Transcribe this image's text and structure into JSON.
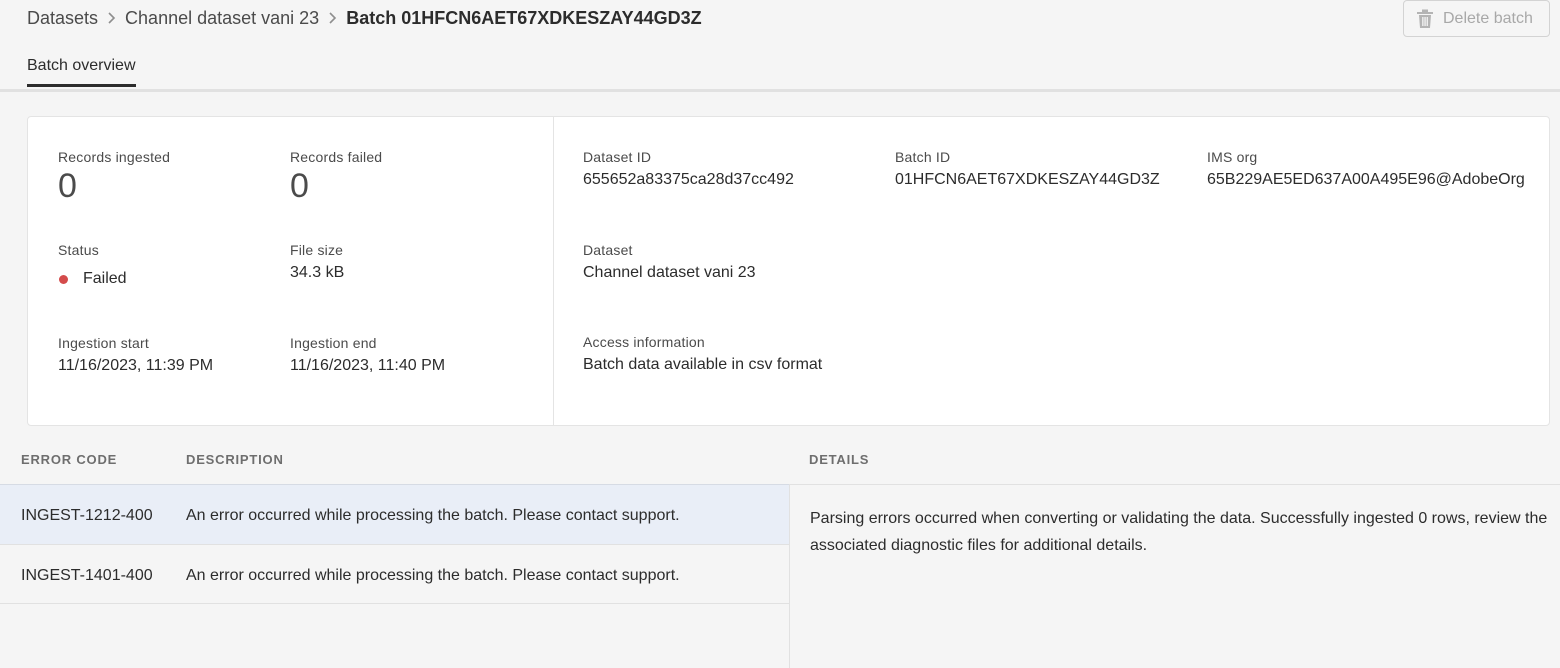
{
  "breadcrumb": {
    "items": [
      "Datasets",
      "Channel dataset vani 23"
    ],
    "current": "Batch 01HFCN6AET67XDKESZAY44GD3Z"
  },
  "actions": {
    "delete_label": "Delete batch",
    "delete_icon": "trash-icon",
    "delete_disabled": true
  },
  "tabs": [
    {
      "label": "Batch overview",
      "active": true
    }
  ],
  "overview": {
    "records_ingested_label": "Records ingested",
    "records_ingested": "0",
    "records_failed_label": "Records failed",
    "records_failed": "0",
    "status_label": "Status",
    "status": "Failed",
    "status_color": "#d44b4b",
    "file_size_label": "File size",
    "file_size": "34.3 kB",
    "ingestion_start_label": "Ingestion start",
    "ingestion_start": "11/16/2023, 11:39 PM",
    "ingestion_end_label": "Ingestion end",
    "ingestion_end": "11/16/2023, 11:40 PM",
    "dataset_id_label": "Dataset ID",
    "dataset_id": "655652a83375ca28d37cc492",
    "batch_id_label": "Batch ID",
    "batch_id": "01HFCN6AET67XDKESZAY44GD3Z",
    "ims_org_label": "IMS org",
    "ims_org": "65B229AE5ED637A00A495E96@AdobeOrg",
    "dataset_label": "Dataset",
    "dataset": "Channel dataset vani 23",
    "access_label": "Access information",
    "access": "Batch data available in csv format"
  },
  "errors": {
    "headers": {
      "code": "ERROR CODE",
      "description": "DESCRIPTION",
      "details": "DETAILS"
    },
    "rows": [
      {
        "code": "INGEST-1212-400",
        "description": "An error occurred while processing the batch. Please contact support.",
        "selected": true
      },
      {
        "code": "INGEST-1401-400",
        "description": "An error occurred while processing the batch. Please contact support.",
        "selected": false
      }
    ],
    "details_text": "Parsing errors occurred when converting or validating the data. Successfully ingested 0 rows, review the associated diagnostic files for additional details."
  }
}
